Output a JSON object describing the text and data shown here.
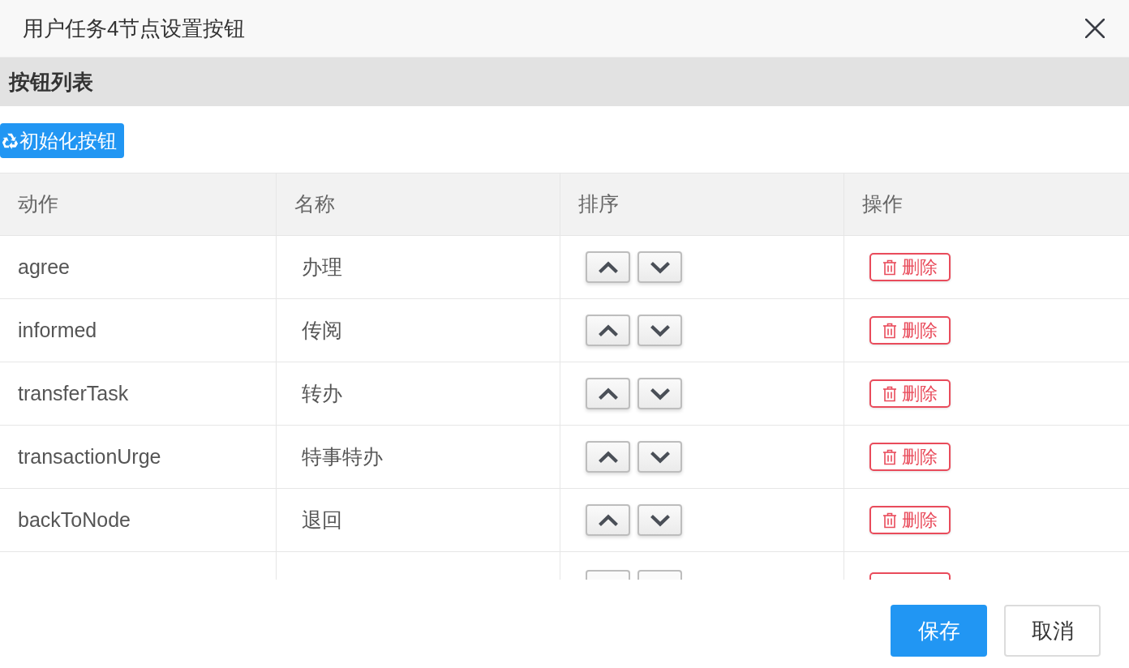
{
  "dialog": {
    "title": "用户任务4节点设置按钮"
  },
  "section": {
    "title": "按钮列表"
  },
  "init_button": {
    "label": "初始化按钮"
  },
  "table": {
    "columns": [
      "动作",
      "名称",
      "排序",
      "操作"
    ],
    "rows": [
      {
        "action": "agree",
        "name": "办理",
        "delete": "删除"
      },
      {
        "action": "informed",
        "name": "传阅",
        "delete": "删除"
      },
      {
        "action": "transferTask",
        "name": "转办",
        "delete": "删除"
      },
      {
        "action": "transactionUrge",
        "name": "特事特办",
        "delete": "删除"
      },
      {
        "action": "backToNode",
        "name": "退回",
        "delete": "删除"
      }
    ]
  },
  "footer": {
    "buttons": [
      {
        "label": "保存",
        "primary": true
      },
      {
        "label": "取消",
        "primary": false
      }
    ]
  }
}
